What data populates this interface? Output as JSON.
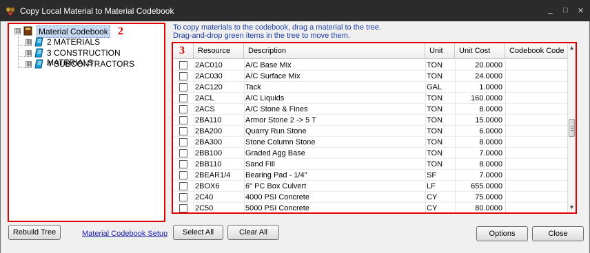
{
  "window": {
    "title": "Copy Local Material to Material Codebook",
    "minimize": "_",
    "maximize": "□",
    "close": "✕"
  },
  "tree": {
    "badge": "2",
    "root": {
      "label": "Material Codebook",
      "expander": "⊟"
    },
    "children": [
      {
        "label": "2 MATERIALS",
        "expander": "⊞"
      },
      {
        "label": "3 CONSTRUCTION MATERIALS",
        "expander": "⊞"
      },
      {
        "label": "4 SUBCONTRACTORS",
        "expander": "⊞"
      }
    ]
  },
  "instructions": {
    "line1": "To copy materials to the codebook, drag a material to the tree.",
    "line2": "Drag-and-drop green items in the tree to move them."
  },
  "grid": {
    "badge": "3",
    "columns": [
      "Resource",
      "Description",
      "Unit",
      "Unit Cost",
      "Codebook Code"
    ],
    "rows": [
      {
        "resource": "2AC010",
        "description": "A/C Base Mix",
        "unit": "TON",
        "cost": "20.0000"
      },
      {
        "resource": "2AC030",
        "description": "A/C Surface Mix",
        "unit": "TON",
        "cost": "24.0000"
      },
      {
        "resource": "2AC120",
        "description": "Tack",
        "unit": "GAL",
        "cost": "1.0000"
      },
      {
        "resource": "2ACL",
        "description": "A/C Liquids",
        "unit": "TON",
        "cost": "160.0000"
      },
      {
        "resource": "2ACS",
        "description": "A/C Stone & Fines",
        "unit": "TON",
        "cost": "8.0000"
      },
      {
        "resource": "2BA110",
        "description": "Armor Stone 2 -> 5 T",
        "unit": "TON",
        "cost": "15.0000"
      },
      {
        "resource": "2BA200",
        "description": "Quarry Run Stone",
        "unit": "TON",
        "cost": "6.0000"
      },
      {
        "resource": "2BA300",
        "description": "Stone Column Stone",
        "unit": "TON",
        "cost": "8.0000"
      },
      {
        "resource": "2BB100",
        "description": "Graded Agg Base",
        "unit": "TON",
        "cost": "7.0000"
      },
      {
        "resource": "2BB110",
        "description": "Sand Fill",
        "unit": "TON",
        "cost": "8.0000"
      },
      {
        "resource": "2BEAR1/4",
        "description": "Bearing Pad - 1/4\"",
        "unit": "SF",
        "cost": "7.0000"
      },
      {
        "resource": "2BOX6",
        "description": "6\" PC Box Culvert",
        "unit": "LF",
        "cost": "655.0000"
      },
      {
        "resource": "2C40",
        "description": "4000 PSI Concrete",
        "unit": "CY",
        "cost": "75.0000"
      },
      {
        "resource": "2C50",
        "description": "5000 PSI Concrete",
        "unit": "CY",
        "cost": "80.0000"
      }
    ]
  },
  "buttons": {
    "rebuild_tree": "Rebuild Tree",
    "codebook_setup": "Material Codebook Setup",
    "select_all": "Select All",
    "clear_all": "Clear All",
    "options": "Options",
    "close": "Close"
  },
  "colors": {
    "highlight_border": "#e00000",
    "link": "#1a1aa8",
    "instruction_text": "#1a3aa8",
    "node_icon": "#1aa0d8"
  }
}
